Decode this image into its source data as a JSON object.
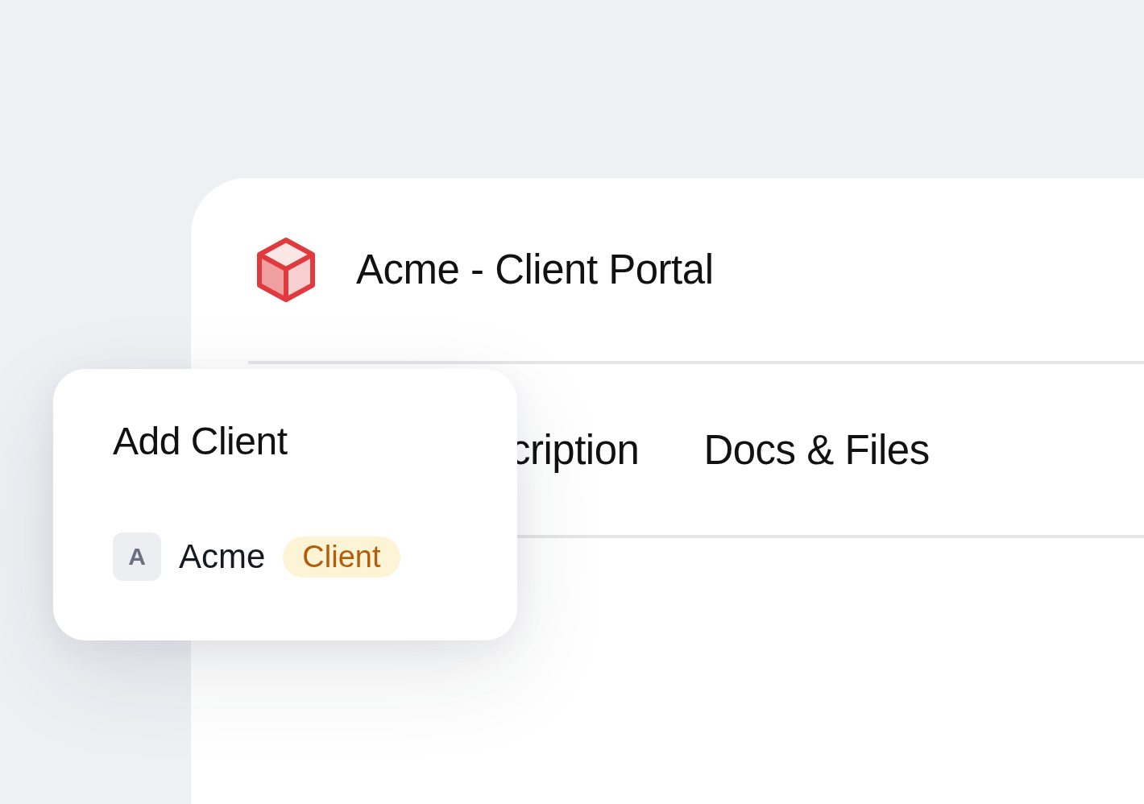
{
  "app": {
    "title": "Acme - Client Portal"
  },
  "tabs": [
    {
      "label": "cription"
    },
    {
      "label": "Docs & Files"
    }
  ],
  "popup": {
    "title": "Add Client",
    "item": {
      "avatar": "A",
      "name": "Acme",
      "badge": "Client"
    }
  }
}
